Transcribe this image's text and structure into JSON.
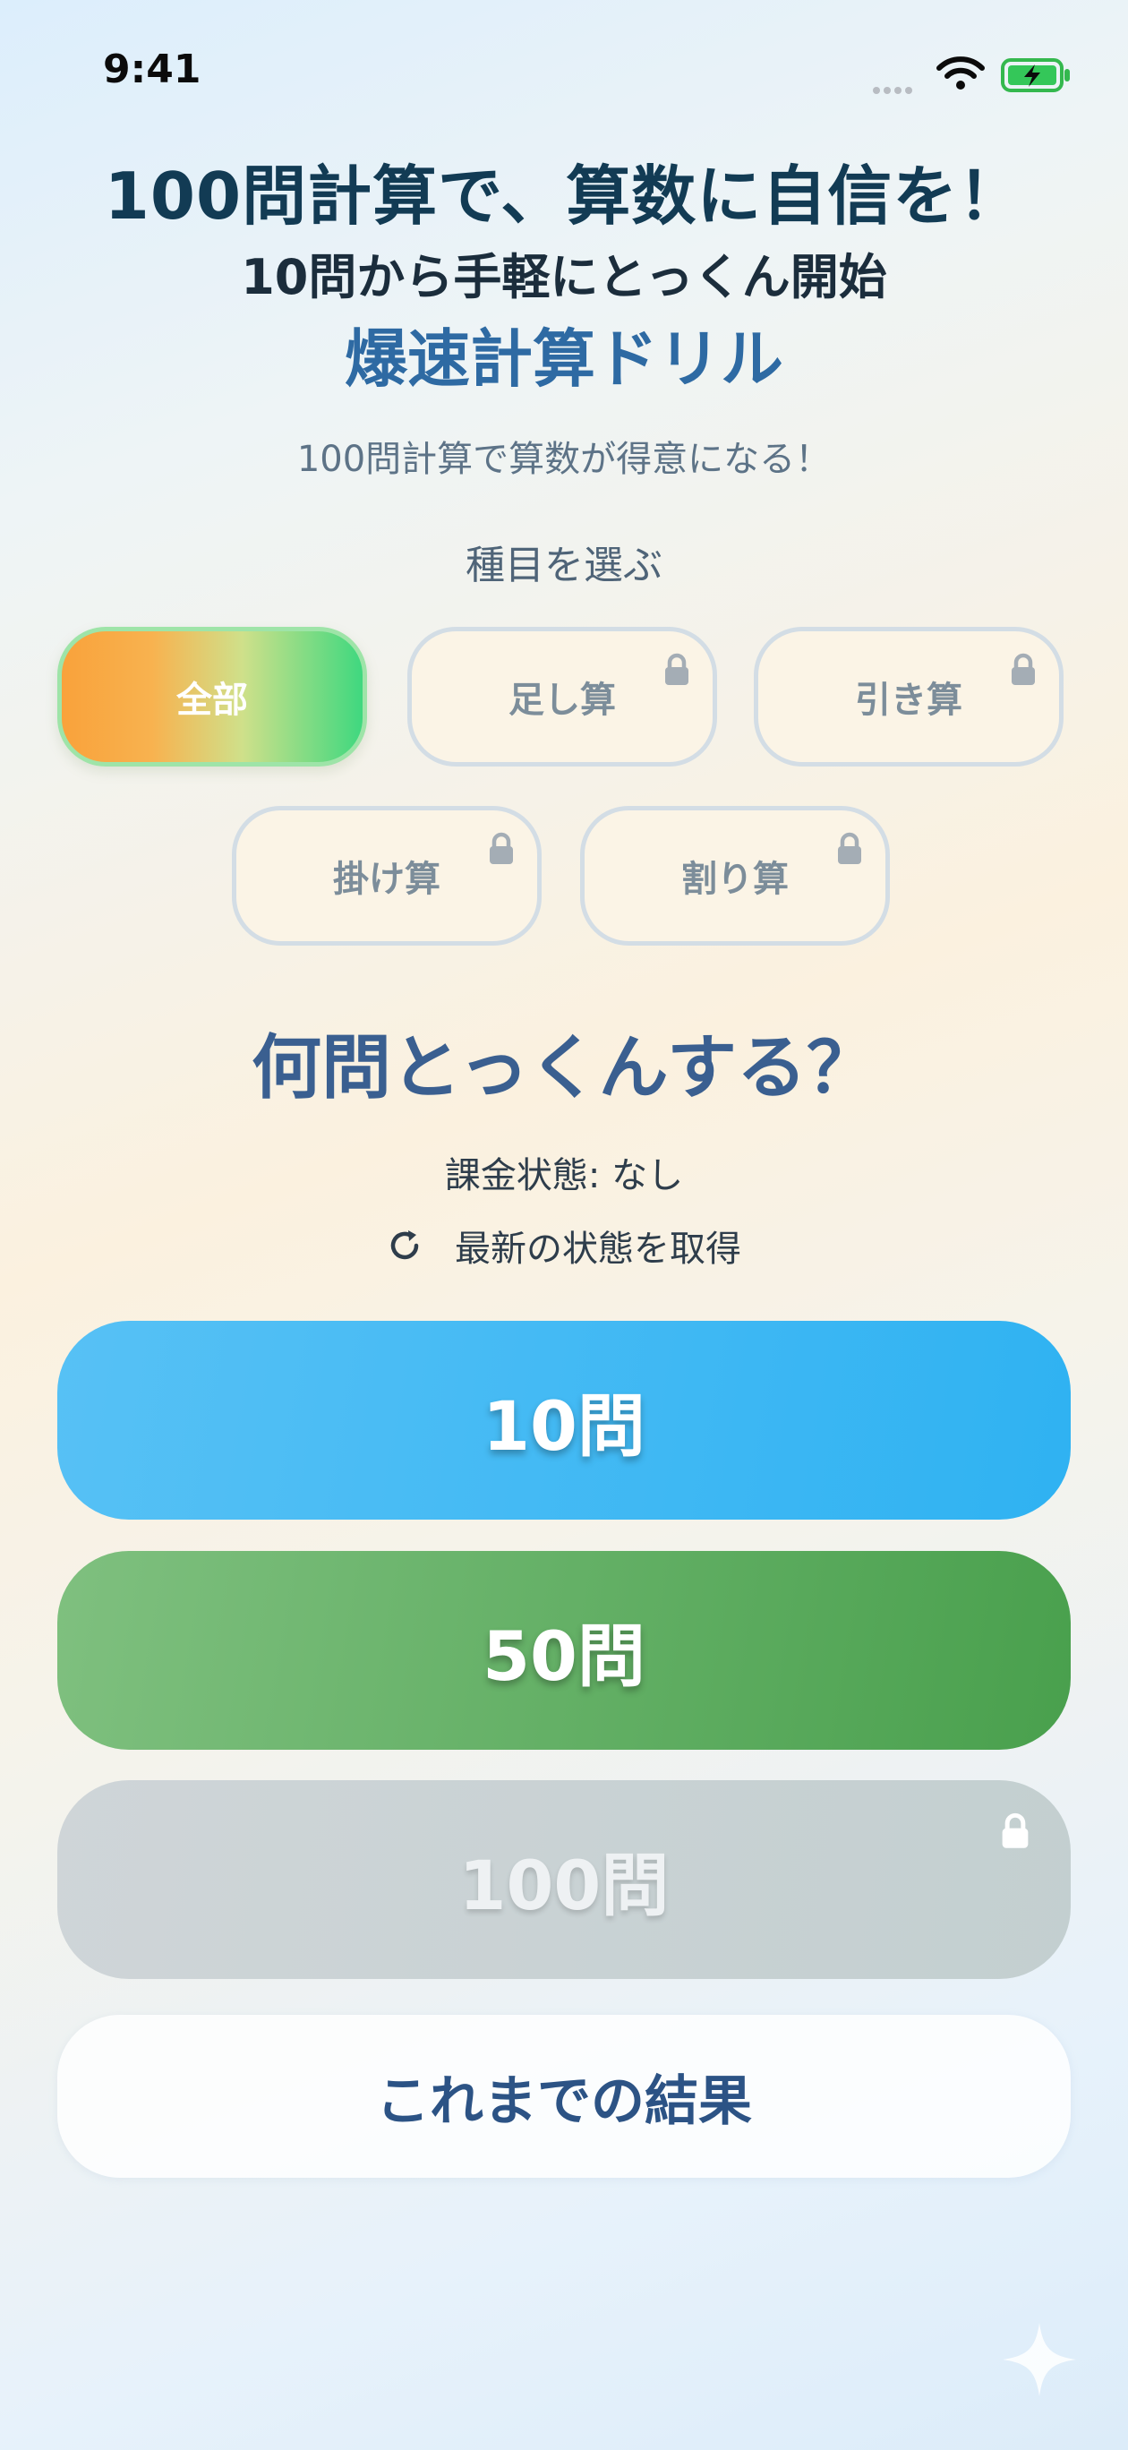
{
  "status_bar": {
    "time": "9:41"
  },
  "header": {
    "headline": "100問計算で、算数に自信を！",
    "subheadline": "10問から手軽にとっくん開始",
    "app_title": "爆速計算ドリル",
    "tagline": "100問計算で算数が得意になる！"
  },
  "categories": {
    "label": "種目を選ぶ",
    "items": [
      {
        "label": "全部",
        "selected": true,
        "locked": false
      },
      {
        "label": "足し算",
        "selected": false,
        "locked": true
      },
      {
        "label": "引き算",
        "selected": false,
        "locked": true
      },
      {
        "label": "掛け算",
        "selected": false,
        "locked": true
      },
      {
        "label": "割り算",
        "selected": false,
        "locked": true
      }
    ]
  },
  "question": {
    "title": "何問とっくんする？",
    "billing_status": "課金状態: なし",
    "refresh_label": "最新の状態を取得"
  },
  "counts": {
    "items": [
      {
        "label": "10問",
        "locked": false,
        "color": "#2fb2f2"
      },
      {
        "label": "50問",
        "locked": false,
        "color": "#49a04d"
      },
      {
        "label": "100問",
        "locked": true,
        "color": "#c8d1d4"
      }
    ]
  },
  "results_button": {
    "label": "これまでの結果"
  },
  "icons": {
    "lock": "lock-icon",
    "refresh": "refresh-icon",
    "wifi": "wifi-icon",
    "battery": "battery-charging-icon",
    "sparkle": "sparkle-icon"
  }
}
